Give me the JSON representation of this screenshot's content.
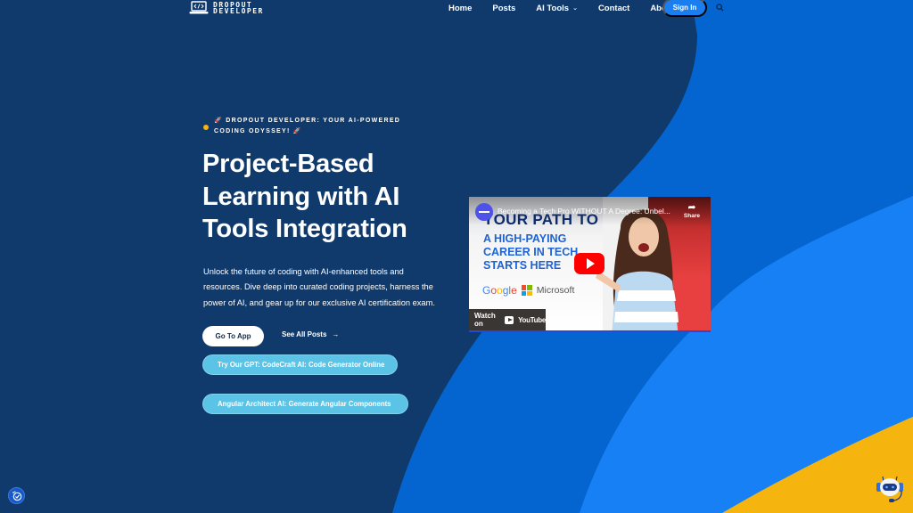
{
  "colors": {
    "navy_bg": "#103a6b",
    "mid_blue": "#0465d0",
    "bright_blue": "#1780f4",
    "yellow": "#f6b40e",
    "pill_button": "#5bc4e6",
    "signin_button": "#1a7ef0"
  },
  "header": {
    "logo": {
      "icon": "laptop-code-icon",
      "line1": "DROPOUT",
      "line2": "DEVELOPER"
    },
    "nav": [
      {
        "label": "Home"
      },
      {
        "label": "Posts"
      },
      {
        "label": "AI Tools",
        "has_dropdown": true
      },
      {
        "label": "Contact"
      },
      {
        "label": "About"
      }
    ],
    "signin_label": "Sign In",
    "search_icon": "search-icon"
  },
  "hero": {
    "tagline": "🚀 DROPOUT DEVELOPER: YOUR AI-POWERED CODING ODYSSEY! 🚀",
    "title": "Project-Based Learning with AI Tools Integration",
    "description": "Unlock the future of coding with AI-enhanced tools and resources. Dive deep into curated coding projects, harness the power of AI, and gear up for our exclusive AI certification exam.",
    "go_to_app_label": "Go To App",
    "see_all_posts_label": "See All Posts",
    "see_all_posts_arrow": "→",
    "gpt_button_label": "Try Our GPT: CodeCraft AI: Code Generator Online",
    "angular_button_label": "Angular Architect AI: Generate Angular Components"
  },
  "video": {
    "title": "Becoming a Tech Pro WITHOUT A Degree: Unbel...",
    "share_label": "Share",
    "thumb_headline": "YOUR PATH TO",
    "thumb_subline": [
      "A HIGH-PAYING",
      "CAREER IN TECH",
      "STARTS HERE"
    ],
    "brand_google": "Google",
    "brand_microsoft": "Microsoft",
    "watch_on_label": "Watch on",
    "youtube_label": "YouTube"
  },
  "floating": {
    "accessibility_icon": "accessibility-icon",
    "chatbot_icon": "robot-chat-icon"
  }
}
